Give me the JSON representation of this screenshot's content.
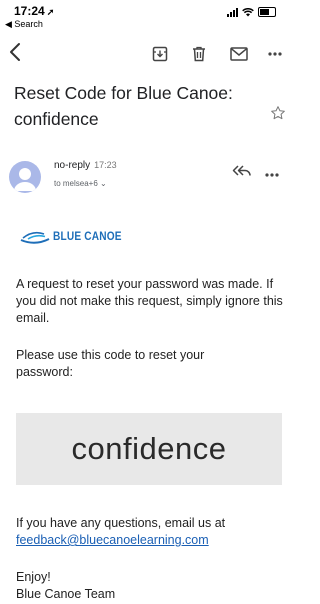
{
  "status_bar": {
    "time": "17:24",
    "location_glyph": "➚",
    "back_label": "◀ Search"
  },
  "toolbar": {
    "icons": [
      "back-icon",
      "archive-icon",
      "trash-icon",
      "mail-icon",
      "more-icon"
    ]
  },
  "email": {
    "subject": "Reset Code for Blue Canoe: confidence",
    "sender": "no-reply",
    "time": "17:23",
    "recipients": "to melsea+6 ⌄",
    "logo_text": "BLUE CANOE",
    "para1": "A request to reset your password was made. If you did not make this request, simply ignore this email.",
    "para2": "Please use this code to reset your password:",
    "code": "confidence",
    "para3": "If you have any questions, email us at",
    "contact_email": "feedback@bluecanoelearning.com",
    "signoff1": "Enjoy!",
    "signoff2": "Blue Canoe Team"
  },
  "colors": {
    "brand": "#1e6eb8",
    "avatar": "#aab8e8",
    "code_bg": "#e8e8e8",
    "link": "#1a5fb4"
  }
}
